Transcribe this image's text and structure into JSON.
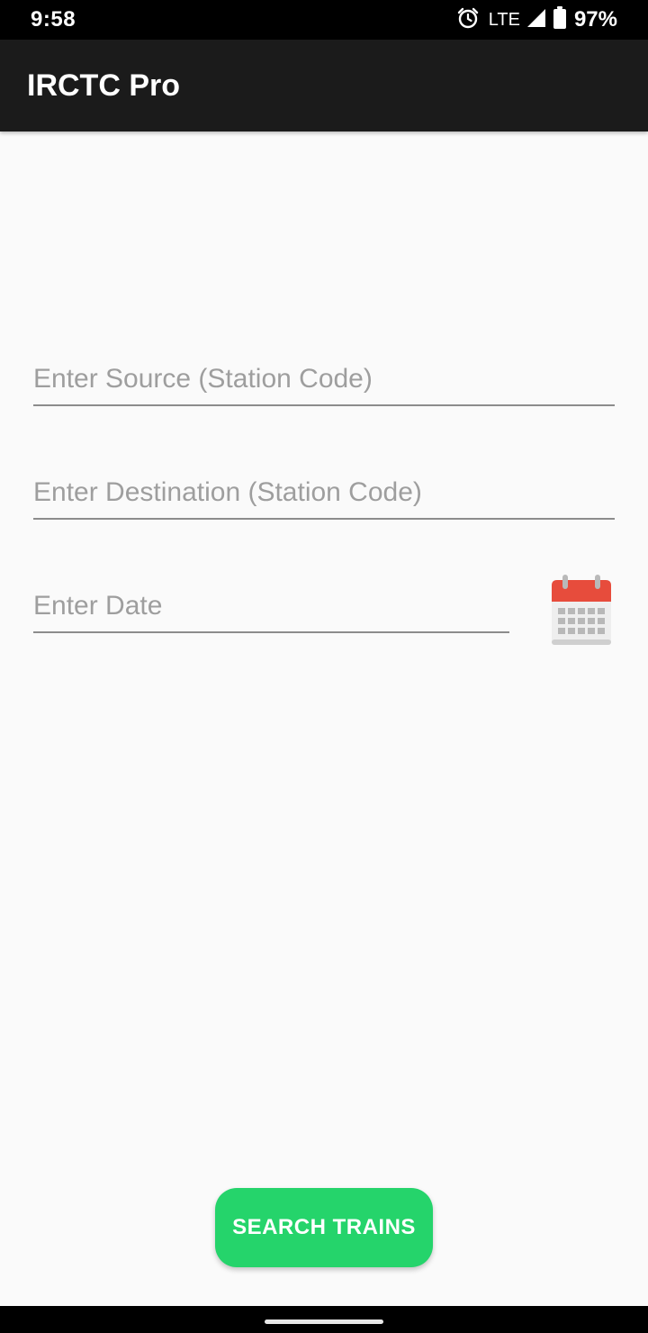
{
  "status_bar": {
    "time": "9:58",
    "network": "LTE",
    "battery": "97%",
    "icons": [
      "alarm-icon",
      "signal-icon",
      "battery-icon"
    ]
  },
  "app_bar": {
    "title": "IRCTC Pro"
  },
  "form": {
    "source": {
      "value": "",
      "placeholder": "Enter Source (Station Code)"
    },
    "destination": {
      "value": "",
      "placeholder": "Enter Destination (Station Code)"
    },
    "date": {
      "value": "",
      "placeholder": "Enter Date"
    },
    "calendar_icon": "calendar-icon"
  },
  "search_button": {
    "label": "SEARCH TRAINS"
  },
  "colors": {
    "status_bar": "#000000",
    "app_bar": "#1b1b1b",
    "background": "#fafafa",
    "accent": "#25d46b",
    "calendar_red": "#e74c3c"
  }
}
